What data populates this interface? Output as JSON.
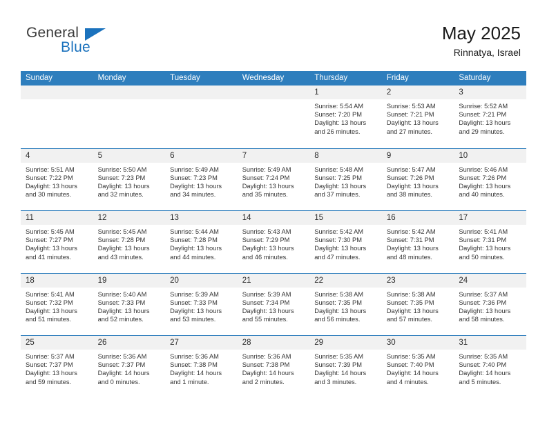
{
  "brand": {
    "name_top": "General",
    "name_bottom": "Blue",
    "accent_color": "#1b72bd"
  },
  "header": {
    "month_title": "May 2025",
    "location": "Rinnatya, Israel"
  },
  "calendar": {
    "header_color": "#2e7ebd",
    "weekdays": [
      "Sunday",
      "Monday",
      "Tuesday",
      "Wednesday",
      "Thursday",
      "Friday",
      "Saturday"
    ],
    "weeks": [
      [
        {
          "day": "",
          "empty": true
        },
        {
          "day": "",
          "empty": true
        },
        {
          "day": "",
          "empty": true
        },
        {
          "day": "",
          "empty": true
        },
        {
          "day": "1",
          "sunrise": "Sunrise: 5:54 AM",
          "sunset": "Sunset: 7:20 PM",
          "daylight": "Daylight: 13 hours and 26 minutes."
        },
        {
          "day": "2",
          "sunrise": "Sunrise: 5:53 AM",
          "sunset": "Sunset: 7:21 PM",
          "daylight": "Daylight: 13 hours and 27 minutes."
        },
        {
          "day": "3",
          "sunrise": "Sunrise: 5:52 AM",
          "sunset": "Sunset: 7:21 PM",
          "daylight": "Daylight: 13 hours and 29 minutes."
        }
      ],
      [
        {
          "day": "4",
          "sunrise": "Sunrise: 5:51 AM",
          "sunset": "Sunset: 7:22 PM",
          "daylight": "Daylight: 13 hours and 30 minutes."
        },
        {
          "day": "5",
          "sunrise": "Sunrise: 5:50 AM",
          "sunset": "Sunset: 7:23 PM",
          "daylight": "Daylight: 13 hours and 32 minutes."
        },
        {
          "day": "6",
          "sunrise": "Sunrise: 5:49 AM",
          "sunset": "Sunset: 7:23 PM",
          "daylight": "Daylight: 13 hours and 34 minutes."
        },
        {
          "day": "7",
          "sunrise": "Sunrise: 5:49 AM",
          "sunset": "Sunset: 7:24 PM",
          "daylight": "Daylight: 13 hours and 35 minutes."
        },
        {
          "day": "8",
          "sunrise": "Sunrise: 5:48 AM",
          "sunset": "Sunset: 7:25 PM",
          "daylight": "Daylight: 13 hours and 37 minutes."
        },
        {
          "day": "9",
          "sunrise": "Sunrise: 5:47 AM",
          "sunset": "Sunset: 7:26 PM",
          "daylight": "Daylight: 13 hours and 38 minutes."
        },
        {
          "day": "10",
          "sunrise": "Sunrise: 5:46 AM",
          "sunset": "Sunset: 7:26 PM",
          "daylight": "Daylight: 13 hours and 40 minutes."
        }
      ],
      [
        {
          "day": "11",
          "sunrise": "Sunrise: 5:45 AM",
          "sunset": "Sunset: 7:27 PM",
          "daylight": "Daylight: 13 hours and 41 minutes."
        },
        {
          "day": "12",
          "sunrise": "Sunrise: 5:45 AM",
          "sunset": "Sunset: 7:28 PM",
          "daylight": "Daylight: 13 hours and 43 minutes."
        },
        {
          "day": "13",
          "sunrise": "Sunrise: 5:44 AM",
          "sunset": "Sunset: 7:28 PM",
          "daylight": "Daylight: 13 hours and 44 minutes."
        },
        {
          "day": "14",
          "sunrise": "Sunrise: 5:43 AM",
          "sunset": "Sunset: 7:29 PM",
          "daylight": "Daylight: 13 hours and 46 minutes."
        },
        {
          "day": "15",
          "sunrise": "Sunrise: 5:42 AM",
          "sunset": "Sunset: 7:30 PM",
          "daylight": "Daylight: 13 hours and 47 minutes."
        },
        {
          "day": "16",
          "sunrise": "Sunrise: 5:42 AM",
          "sunset": "Sunset: 7:31 PM",
          "daylight": "Daylight: 13 hours and 48 minutes."
        },
        {
          "day": "17",
          "sunrise": "Sunrise: 5:41 AM",
          "sunset": "Sunset: 7:31 PM",
          "daylight": "Daylight: 13 hours and 50 minutes."
        }
      ],
      [
        {
          "day": "18",
          "sunrise": "Sunrise: 5:41 AM",
          "sunset": "Sunset: 7:32 PM",
          "daylight": "Daylight: 13 hours and 51 minutes."
        },
        {
          "day": "19",
          "sunrise": "Sunrise: 5:40 AM",
          "sunset": "Sunset: 7:33 PM",
          "daylight": "Daylight: 13 hours and 52 minutes."
        },
        {
          "day": "20",
          "sunrise": "Sunrise: 5:39 AM",
          "sunset": "Sunset: 7:33 PM",
          "daylight": "Daylight: 13 hours and 53 minutes."
        },
        {
          "day": "21",
          "sunrise": "Sunrise: 5:39 AM",
          "sunset": "Sunset: 7:34 PM",
          "daylight": "Daylight: 13 hours and 55 minutes."
        },
        {
          "day": "22",
          "sunrise": "Sunrise: 5:38 AM",
          "sunset": "Sunset: 7:35 PM",
          "daylight": "Daylight: 13 hours and 56 minutes."
        },
        {
          "day": "23",
          "sunrise": "Sunrise: 5:38 AM",
          "sunset": "Sunset: 7:35 PM",
          "daylight": "Daylight: 13 hours and 57 minutes."
        },
        {
          "day": "24",
          "sunrise": "Sunrise: 5:37 AM",
          "sunset": "Sunset: 7:36 PM",
          "daylight": "Daylight: 13 hours and 58 minutes."
        }
      ],
      [
        {
          "day": "25",
          "sunrise": "Sunrise: 5:37 AM",
          "sunset": "Sunset: 7:37 PM",
          "daylight": "Daylight: 13 hours and 59 minutes."
        },
        {
          "day": "26",
          "sunrise": "Sunrise: 5:36 AM",
          "sunset": "Sunset: 7:37 PM",
          "daylight": "Daylight: 14 hours and 0 minutes."
        },
        {
          "day": "27",
          "sunrise": "Sunrise: 5:36 AM",
          "sunset": "Sunset: 7:38 PM",
          "daylight": "Daylight: 14 hours and 1 minute."
        },
        {
          "day": "28",
          "sunrise": "Sunrise: 5:36 AM",
          "sunset": "Sunset: 7:38 PM",
          "daylight": "Daylight: 14 hours and 2 minutes."
        },
        {
          "day": "29",
          "sunrise": "Sunrise: 5:35 AM",
          "sunset": "Sunset: 7:39 PM",
          "daylight": "Daylight: 14 hours and 3 minutes."
        },
        {
          "day": "30",
          "sunrise": "Sunrise: 5:35 AM",
          "sunset": "Sunset: 7:40 PM",
          "daylight": "Daylight: 14 hours and 4 minutes."
        },
        {
          "day": "31",
          "sunrise": "Sunrise: 5:35 AM",
          "sunset": "Sunset: 7:40 PM",
          "daylight": "Daylight: 14 hours and 5 minutes."
        }
      ]
    ]
  }
}
